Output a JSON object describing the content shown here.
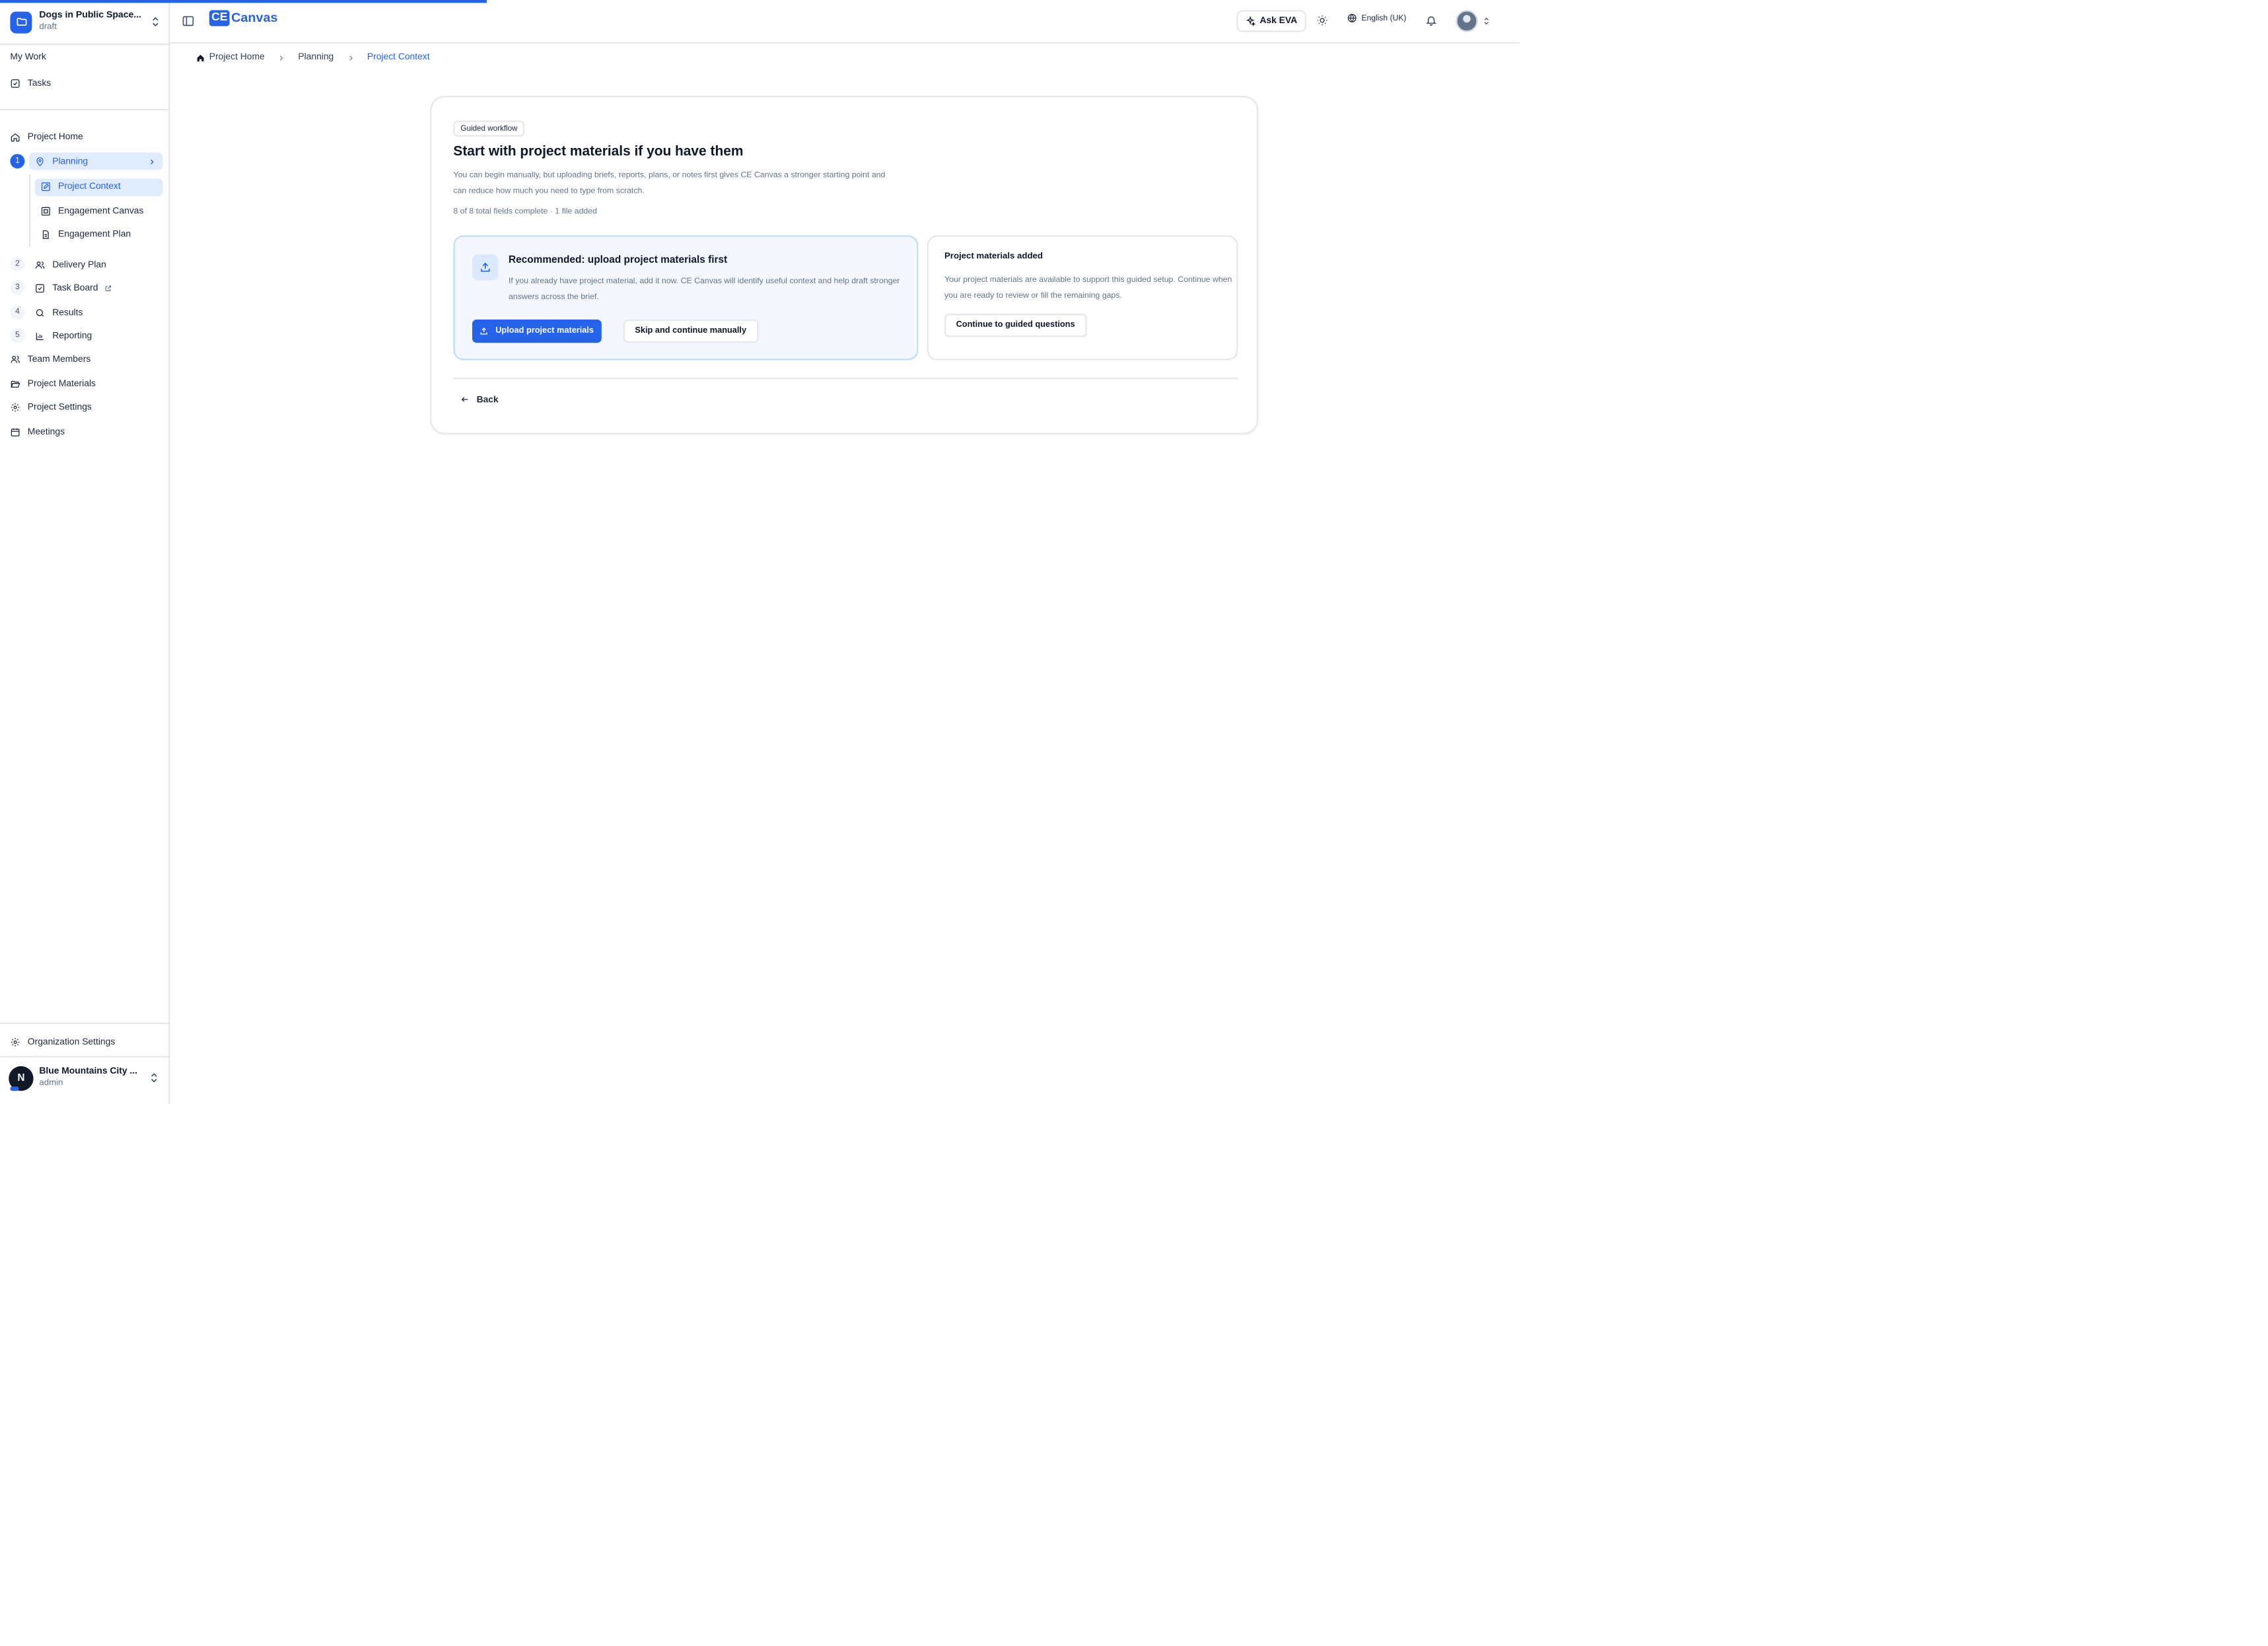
{
  "project": {
    "name": "Dogs in Public Space...",
    "status": "draft"
  },
  "sidebar": {
    "my_work_label": "My Work",
    "tasks_label": "Tasks",
    "project_home_label": "Project Home",
    "planning": {
      "step": "1",
      "label": "Planning"
    },
    "planning_sub": [
      "Project Context",
      "Engagement Canvas",
      "Engagement Plan"
    ],
    "steps": [
      {
        "step": "2",
        "label": "Delivery Plan"
      },
      {
        "step": "3",
        "label": "Task Board"
      },
      {
        "step": "4",
        "label": "Results"
      },
      {
        "step": "5",
        "label": "Reporting"
      }
    ],
    "team_members_label": "Team Members",
    "project_materials_label": "Project Materials",
    "project_settings_label": "Project Settings",
    "meetings_label": "Meetings",
    "org_settings_label": "Organization Settings"
  },
  "org": {
    "initial": "N",
    "name": "Blue Mountains City ...",
    "role": "admin"
  },
  "topbar": {
    "logo_ce": "CE",
    "logo_canvas": "Canvas",
    "ask_eva_label": "Ask EVA",
    "language": "English (UK)"
  },
  "breadcrumb": [
    "Project Home",
    "Planning",
    "Project Context"
  ],
  "card": {
    "badge": "Guided workflow",
    "title": "Start with project materials if you have them",
    "description": "You can begin manually, but uploading briefs, reports, plans, or notes first gives CE Canvas a stronger starting point and can reduce how much you need to type from scratch.",
    "status": "8 of 8 total fields complete · 1 file added",
    "recommended": {
      "title": "Recommended: upload project materials first",
      "description": "If you already have project material, add it now. CE Canvas will identify useful context and help draft stronger answers across the brief.",
      "upload_label": "Upload project materials",
      "skip_label": "Skip and continue manually"
    },
    "added": {
      "title": "Project materials added",
      "description": "Your project materials are available to support this guided setup. Continue when you are ready to review or fill the remaining gaps.",
      "continue_label": "Continue to guided questions"
    },
    "back_label": "Back"
  },
  "colors": {
    "accent": "#2563eb",
    "accent_light": "#e0ecfd",
    "border": "#e5e7eb",
    "muted_text": "#64748b"
  }
}
